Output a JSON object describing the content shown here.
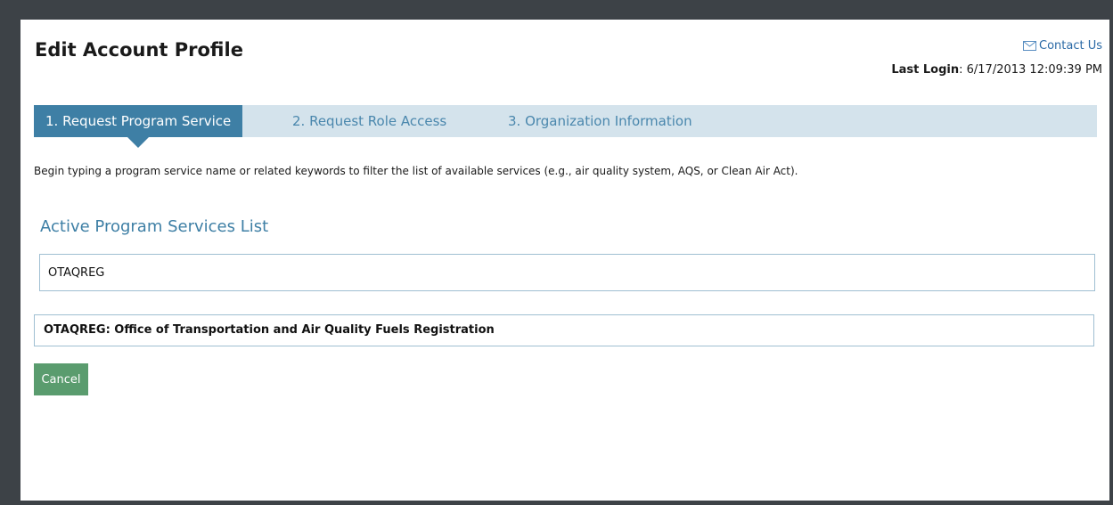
{
  "header": {
    "title": "Edit Account Profile",
    "contact_label": "Contact Us",
    "last_login_label": "Last Login",
    "last_login_value": ": 6/17/2013 12:09:39 PM"
  },
  "tabs": [
    {
      "label": "1. Request Program Service",
      "active": true
    },
    {
      "label": "2. Request Role Access",
      "active": false
    },
    {
      "label": "3. Organization Information",
      "active": false
    }
  ],
  "instructions": "Begin typing a program service name or related keywords to filter the list of available services (e.g., air quality system, AQS, or Clean Air Act).",
  "services": {
    "section_title": "Active Program Services List",
    "search_value": "OTAQREG",
    "results": [
      "OTAQREG: Office of Transportation and Air Quality Fuels Registration"
    ]
  },
  "actions": {
    "cancel_label": "Cancel"
  },
  "colors": {
    "accent": "#3e7fa5",
    "tab_bar": "#d4e3ec",
    "cancel_button": "#5a9c6e",
    "link": "#2b6aa6",
    "frame": "#3d4247"
  },
  "icons": {
    "contact": "mail-icon"
  }
}
